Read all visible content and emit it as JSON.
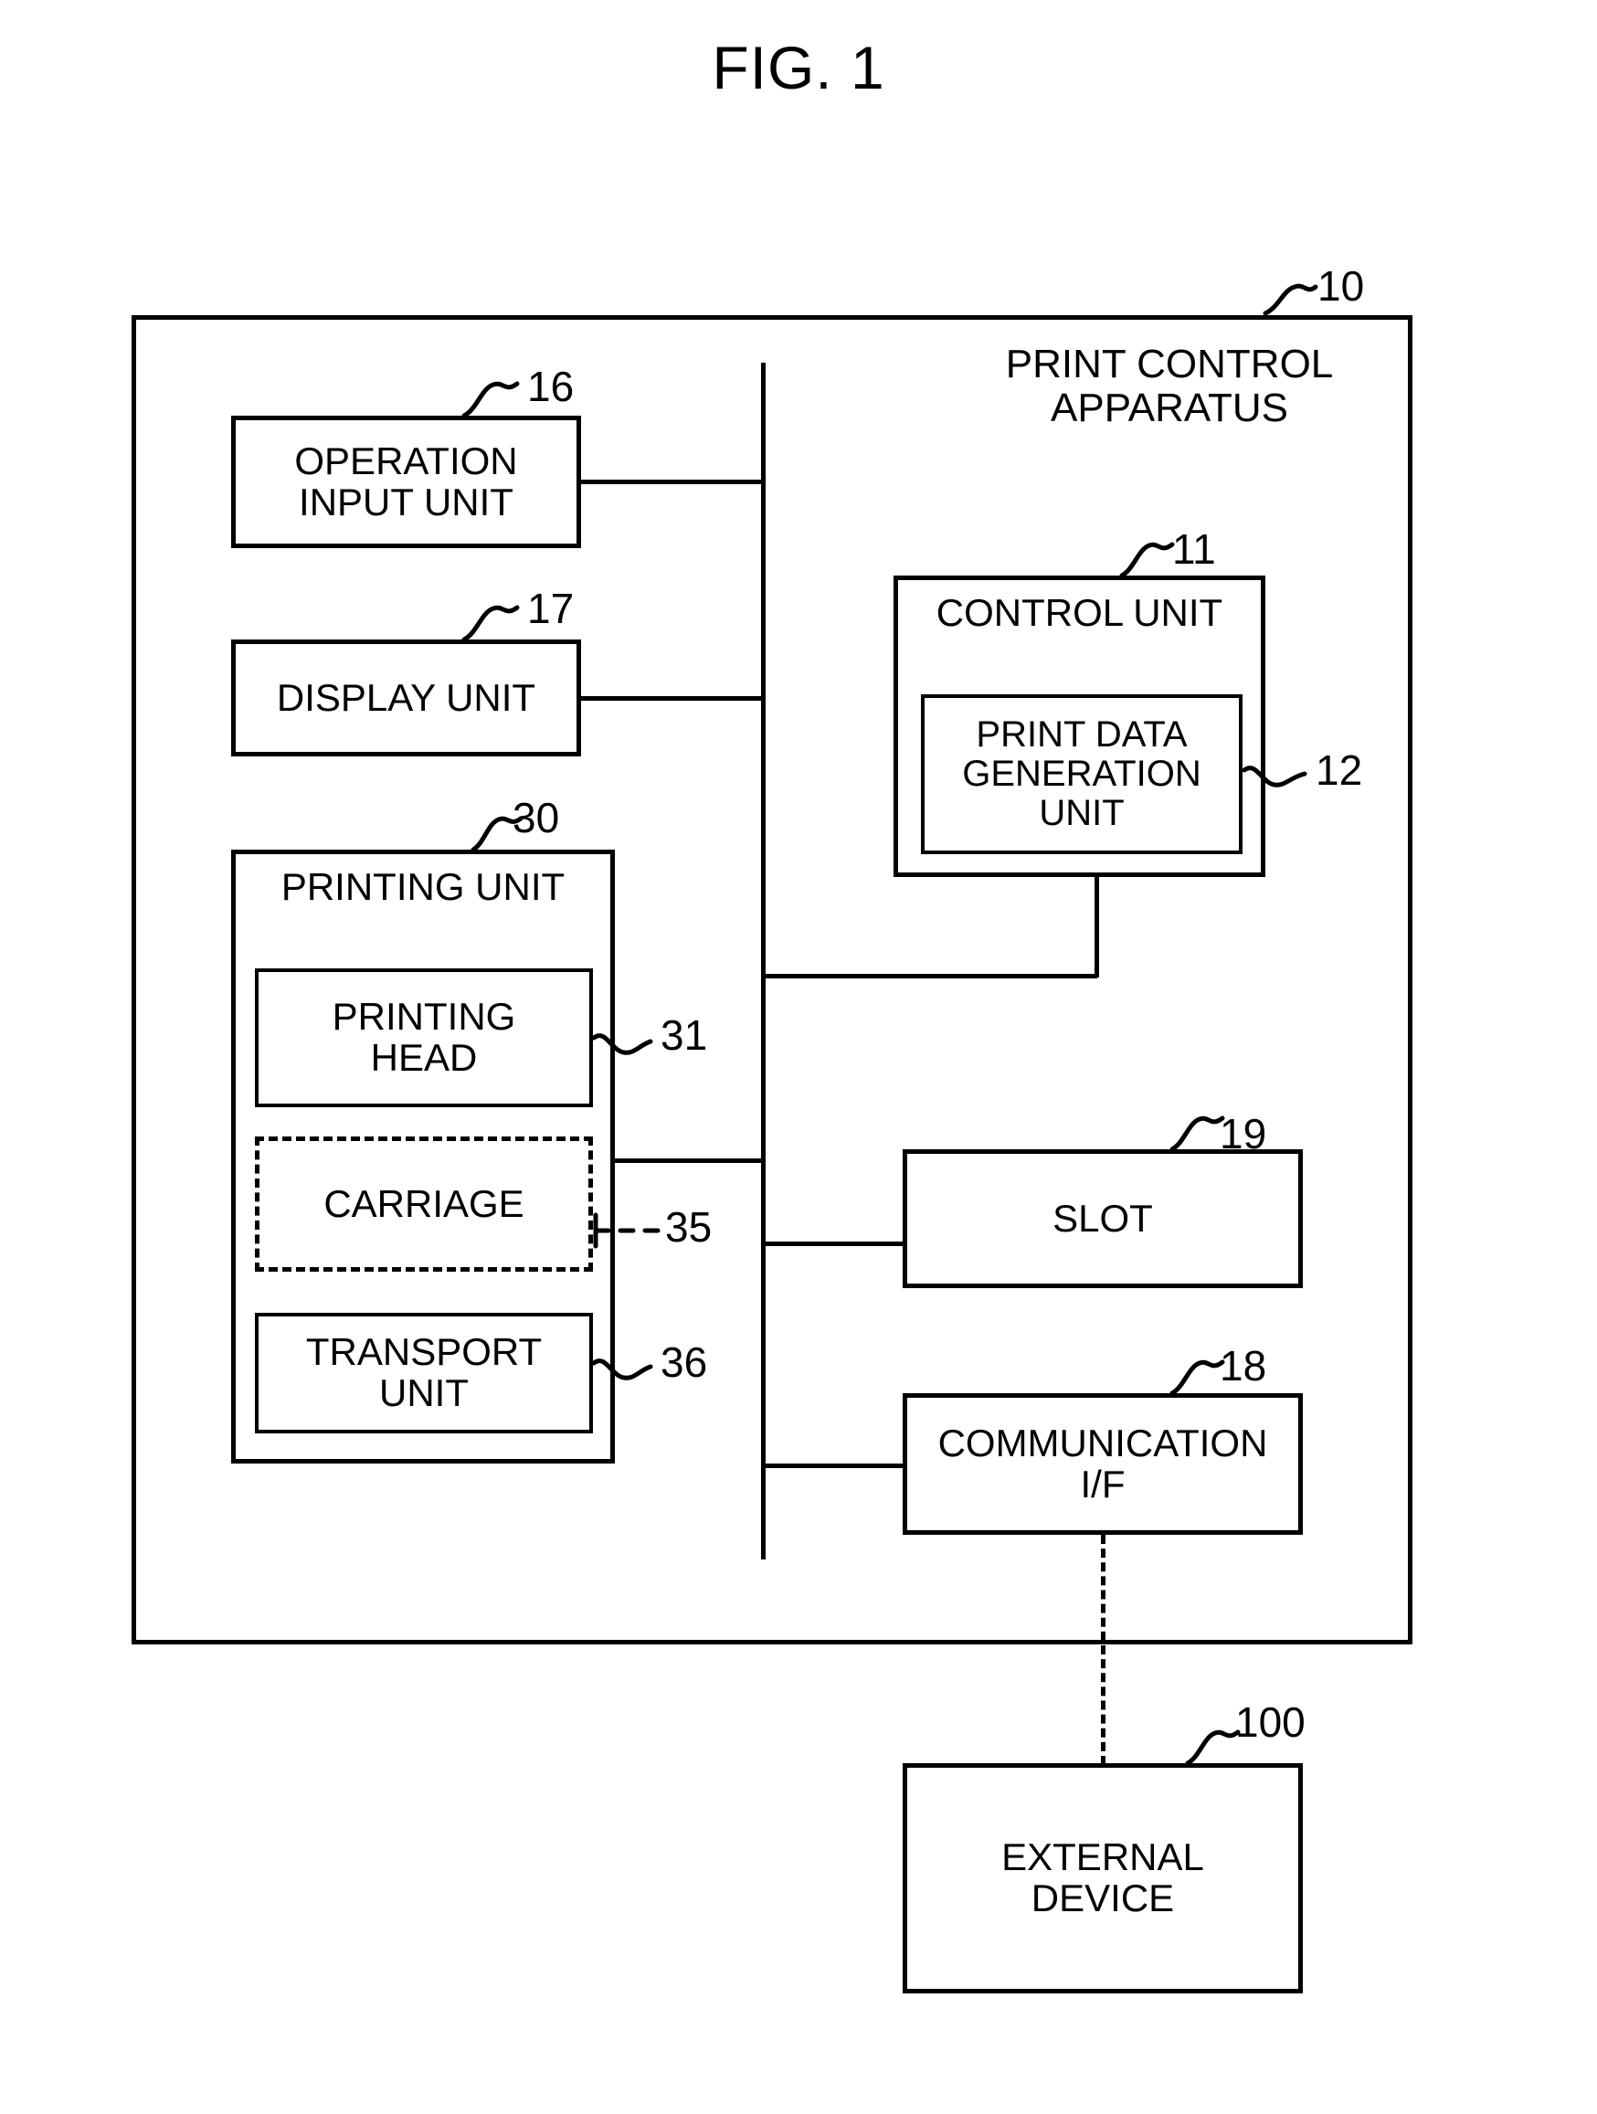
{
  "figure": {
    "title": "FIG. 1"
  },
  "apparatus": {
    "label": "PRINT CONTROL\nAPPARATUS",
    "ref": "10"
  },
  "blocks": {
    "operation_input_unit": {
      "label": "OPERATION\nINPUT UNIT",
      "ref": "16"
    },
    "display_unit": {
      "label": "DISPLAY UNIT",
      "ref": "17"
    },
    "printing_unit": {
      "label": "PRINTING UNIT",
      "ref": "30"
    },
    "printing_head": {
      "label": "PRINTING\nHEAD",
      "ref": "31"
    },
    "carriage": {
      "label": "CARRIAGE",
      "ref": "35"
    },
    "transport_unit": {
      "label": "TRANSPORT\nUNIT",
      "ref": "36"
    },
    "control_unit": {
      "label": "CONTROL UNIT",
      "ref": "11"
    },
    "print_data_generation_unit": {
      "label": "PRINT DATA\nGENERATION\nUNIT",
      "ref": "12"
    },
    "slot": {
      "label": "SLOT",
      "ref": "19"
    },
    "communication_if": {
      "label": "COMMUNICATION\nI/F",
      "ref": "18"
    },
    "external_device": {
      "label": "EXTERNAL\nDEVICE",
      "ref": "100"
    }
  },
  "colors": {
    "ink": "#000000",
    "paper": "#ffffff"
  }
}
